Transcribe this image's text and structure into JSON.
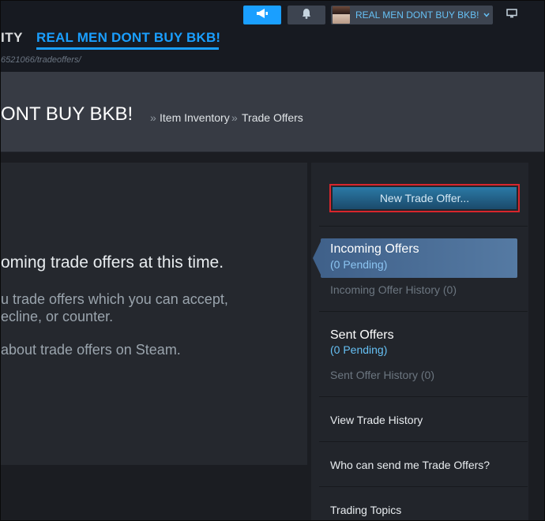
{
  "topbar": {
    "account_name": "REAL MEN DONT BUY BKB!",
    "accent": "#1a9fff",
    "icons": [
      "megaphone-icon",
      "bell-icon",
      "chevron-down-icon",
      "monitor-icon"
    ]
  },
  "nav": {
    "community": "ITY",
    "user": "REAL MEN DONT BUY BKB!",
    "url": "6521066/tradeoffers/"
  },
  "header": {
    "title": "ONT BUY BKB!",
    "sep1": "»",
    "crumb_inventory": "Item Inventory",
    "sep2": "»",
    "crumb_trade_offers": "Trade Offers"
  },
  "main": {
    "none_msg": "oming trade offers at this time.",
    "line1": "u trade offers which you can accept,",
    "line2": "ecline, or counter.",
    "line3": "about trade offers on Steam."
  },
  "sidebar": {
    "new_offer_label": "New Trade Offer...",
    "incoming_title": "Incoming Offers",
    "incoming_pending": "(0 Pending)",
    "incoming_history": "Incoming Offer History (0)",
    "sent_title": "Sent Offers",
    "sent_pending": "(0 Pending)",
    "sent_history": "Sent Offer History (0)",
    "view_history": "View Trade History",
    "who_can_send": "Who can send me Trade Offers?",
    "trading_topics": "Trading Topics"
  }
}
